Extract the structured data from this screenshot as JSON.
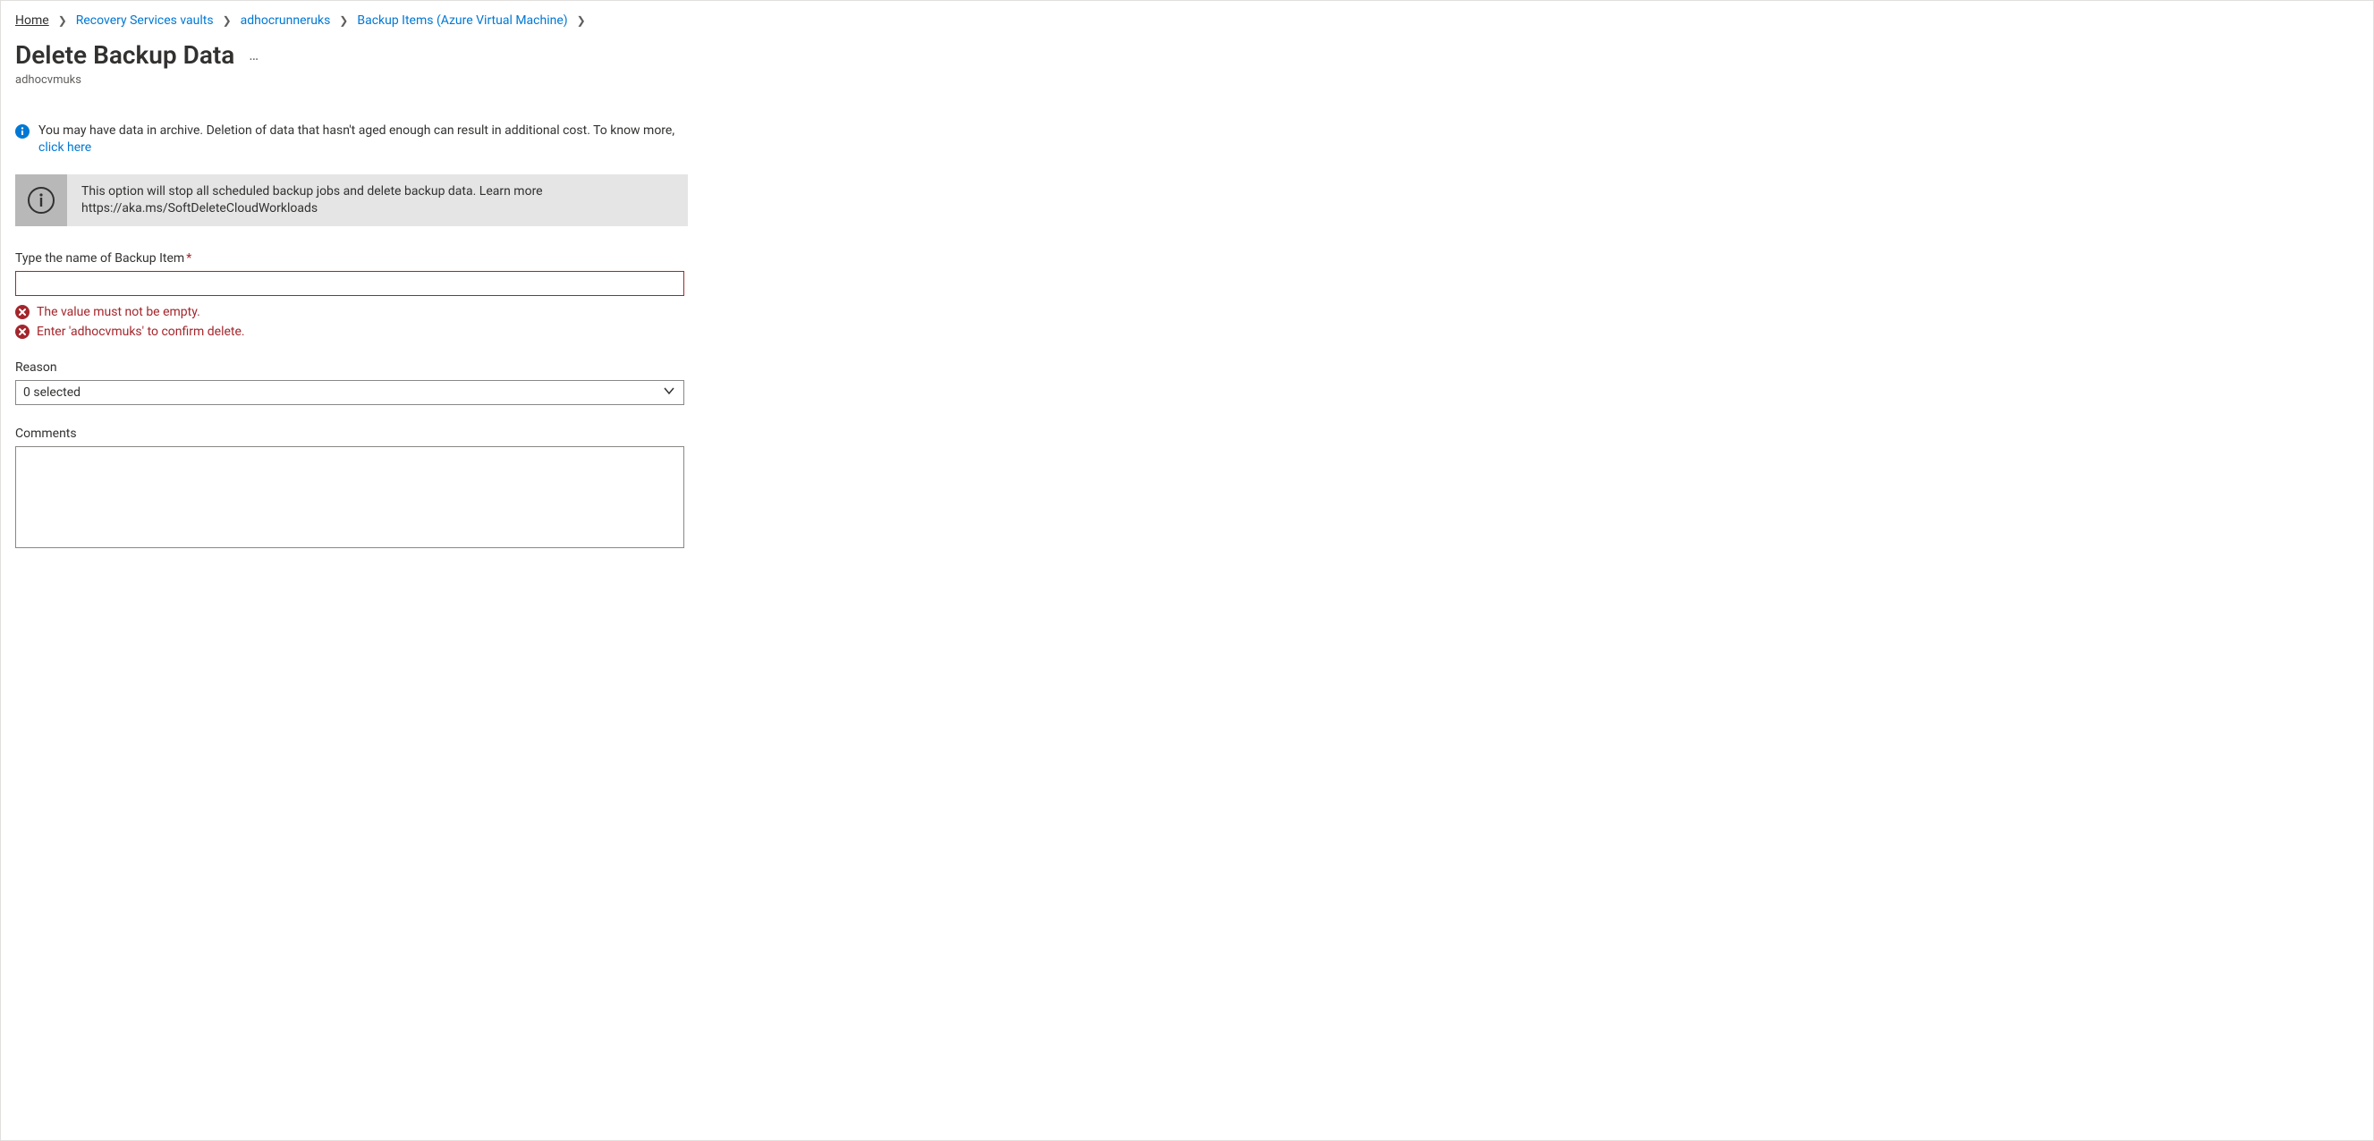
{
  "breadcrumb": {
    "home": "Home",
    "item1": "Recovery Services vaults",
    "item2": "adhocrunneruks",
    "item3": "Backup Items (Azure Virtual Machine)"
  },
  "page": {
    "title": "Delete Backup Data",
    "subtitle": "adhocvmuks"
  },
  "banners": {
    "archive_text_before_link": "You may have data in archive. Deletion of data that hasn't aged enough can result in additional cost. To know more, ",
    "archive_link": "click here",
    "gray_line1": "This option will stop all scheduled backup jobs and delete backup data. Learn more",
    "gray_line2": "https://aka.ms/SoftDeleteCloudWorkloads"
  },
  "form": {
    "name_label": "Type the name of Backup Item",
    "name_value": "",
    "error_empty": "The value must not be empty.",
    "error_confirm": "Enter 'adhocvmuks' to confirm delete.",
    "reason_label": "Reason",
    "reason_selected": "0 selected",
    "comments_label": "Comments",
    "comments_value": ""
  }
}
